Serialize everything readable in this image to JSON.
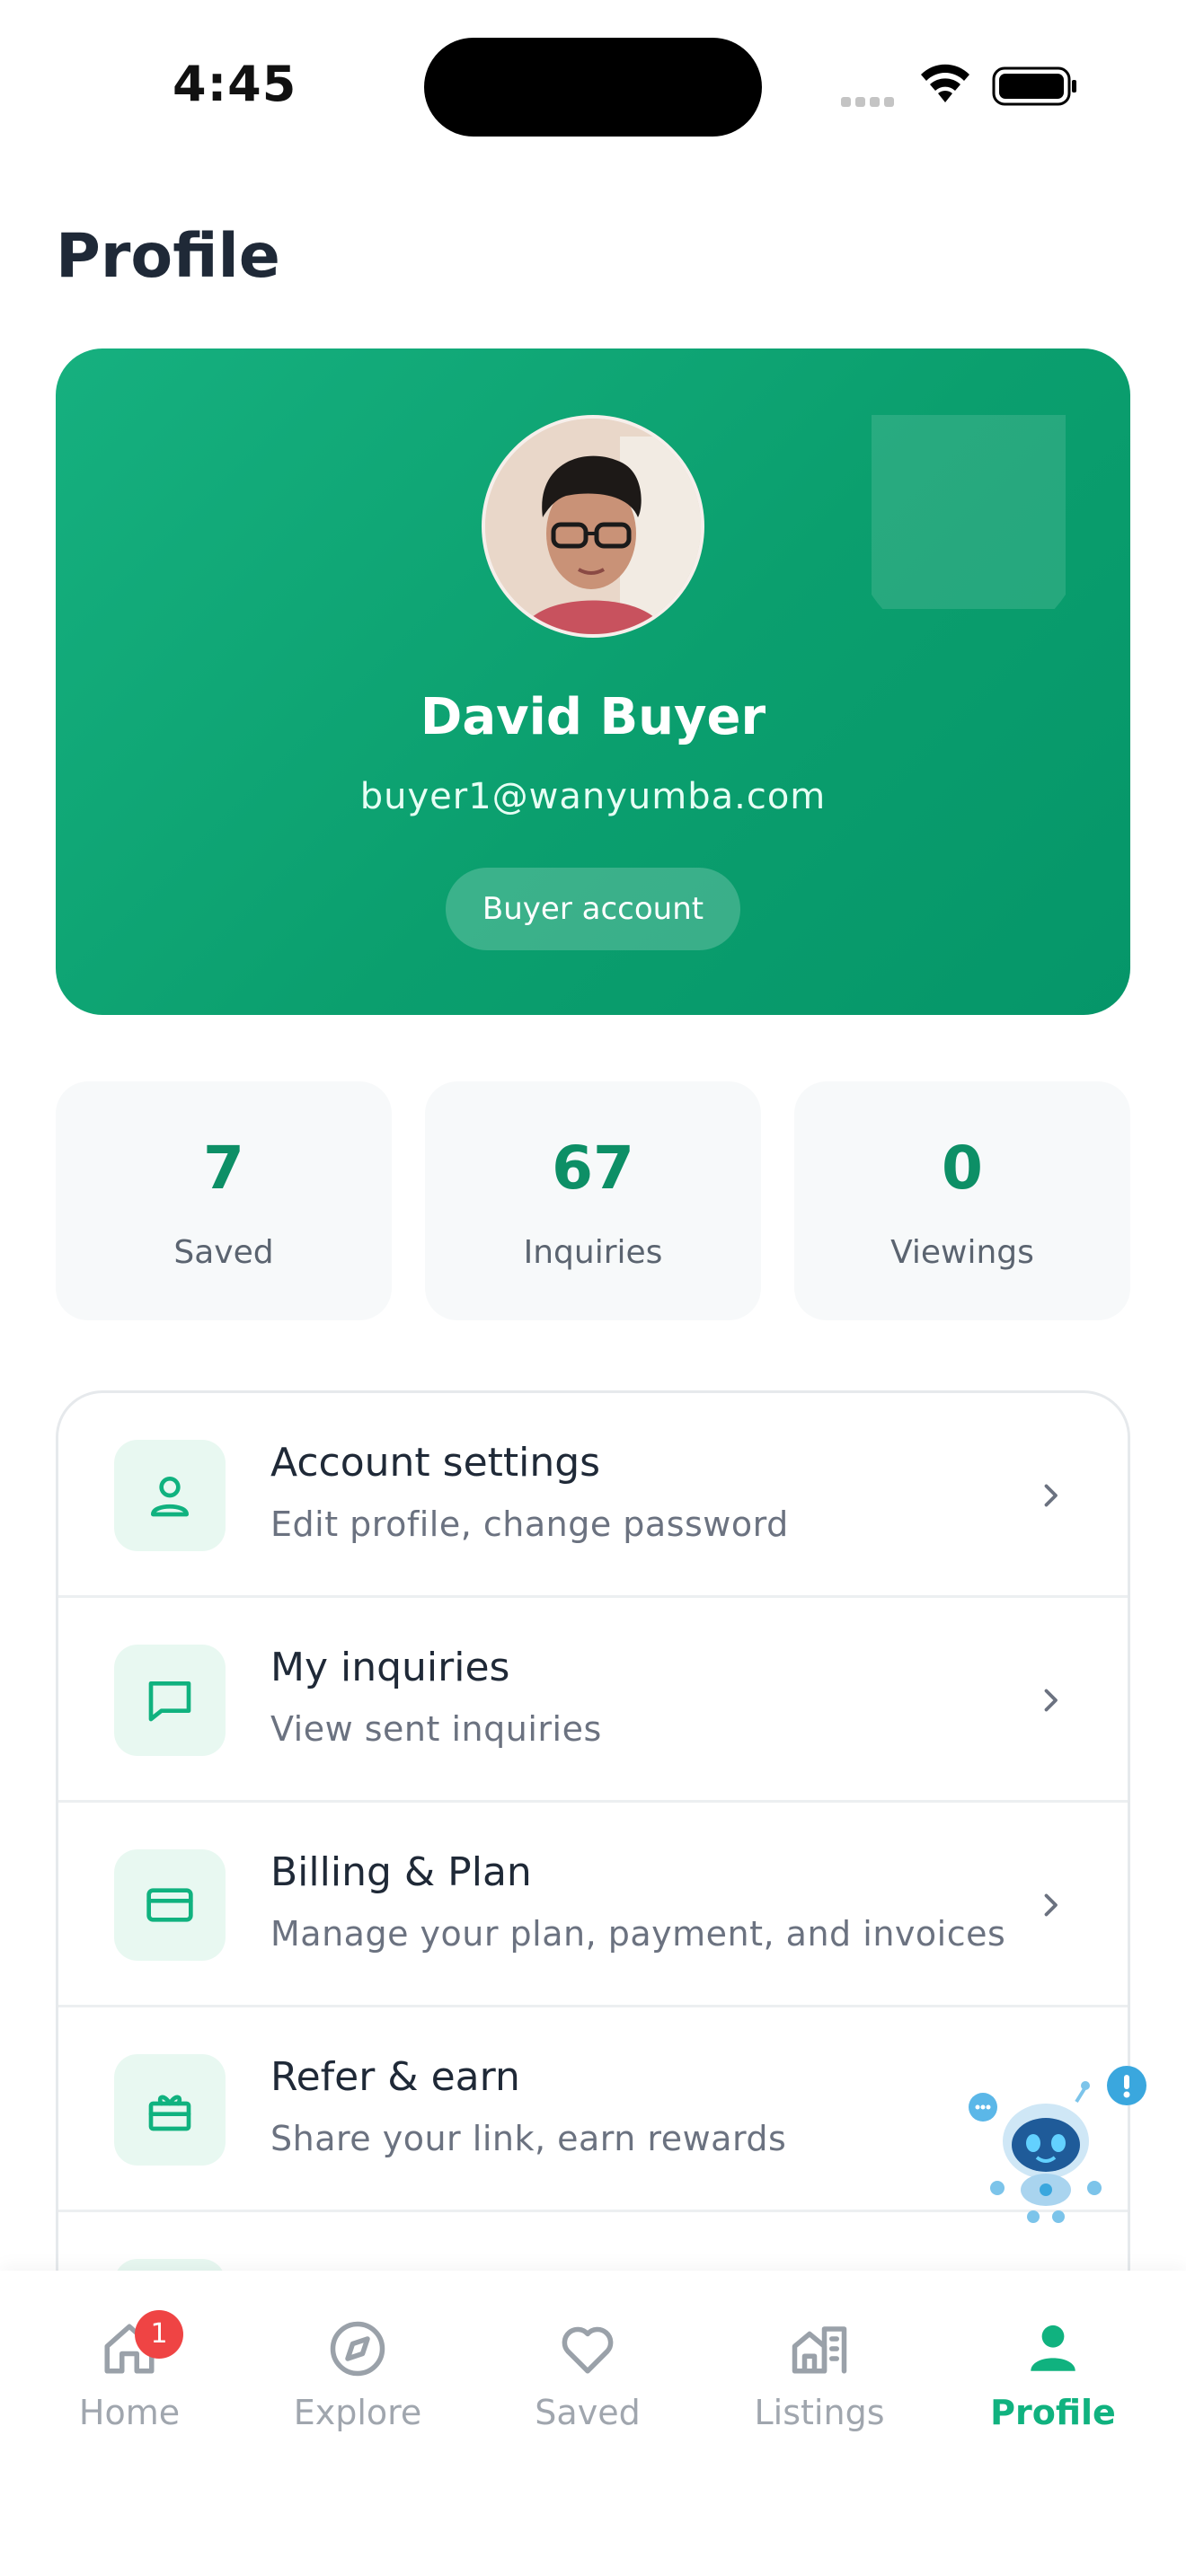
{
  "status_bar": {
    "time": "4:45"
  },
  "page": {
    "title": "Profile"
  },
  "profile": {
    "name": "David Buyer",
    "email": "buyer1@wanyumba.com",
    "account_type": "Buyer account"
  },
  "stats": [
    {
      "value": "7",
      "label": "Saved"
    },
    {
      "value": "67",
      "label": "Inquiries"
    },
    {
      "value": "0",
      "label": "Viewings"
    }
  ],
  "menu": [
    {
      "icon": "user-icon",
      "title": "Account settings",
      "subtitle": "Edit profile, change password"
    },
    {
      "icon": "message-icon",
      "title": "My inquiries",
      "subtitle": "View sent inquiries"
    },
    {
      "icon": "credit-card-icon",
      "title": "Billing & Plan",
      "subtitle": "Manage your plan, payment, and invoices"
    },
    {
      "icon": "gift-icon",
      "title": "Refer & earn",
      "subtitle": "Share your link, earn rewards"
    }
  ],
  "tabs": [
    {
      "label": "Home",
      "icon": "home-icon",
      "badge": "1"
    },
    {
      "label": "Explore",
      "icon": "compass-icon"
    },
    {
      "label": "Saved",
      "icon": "heart-icon"
    },
    {
      "label": "Listings",
      "icon": "building-icon"
    },
    {
      "label": "Profile",
      "icon": "person-icon",
      "active": true
    }
  ],
  "colors": {
    "accent": "#10b27f",
    "card_gradient_start": "#16b07f",
    "card_gradient_end": "#059669",
    "badge": "#ef4444"
  }
}
